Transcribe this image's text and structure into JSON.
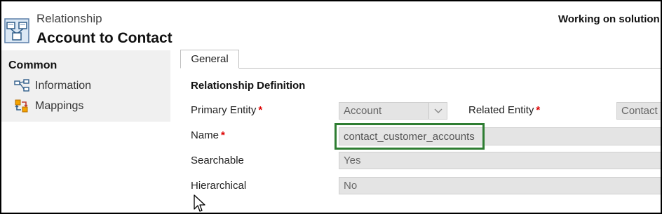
{
  "header": {
    "entity_type": "Relationship",
    "record_title": "Account to Contact",
    "solution_text": "Working on solution"
  },
  "nav": {
    "section": "Common",
    "items": [
      {
        "label": "Information",
        "icon": "information-icon"
      },
      {
        "label": "Mappings",
        "icon": "mappings-icon"
      }
    ]
  },
  "tabs": [
    {
      "label": "General",
      "active": true
    }
  ],
  "form": {
    "section_title": "Relationship Definition",
    "primary_entity": {
      "label": "Primary Entity",
      "required": "*",
      "value": "Account"
    },
    "related_entity": {
      "label": "Related Entity",
      "required": "*",
      "value": "Contact"
    },
    "name": {
      "label": "Name",
      "required": "*",
      "value": "contact_customer_accounts"
    },
    "searchable": {
      "label": "Searchable",
      "value": "Yes"
    },
    "hierarchical": {
      "label": "Hierarchical",
      "value": "No"
    }
  },
  "colors": {
    "highlight_border": "#2e7d32",
    "required_marker": "#dd0000",
    "field_background": "#e4e4e4",
    "nav_background": "#f0f0f0"
  }
}
